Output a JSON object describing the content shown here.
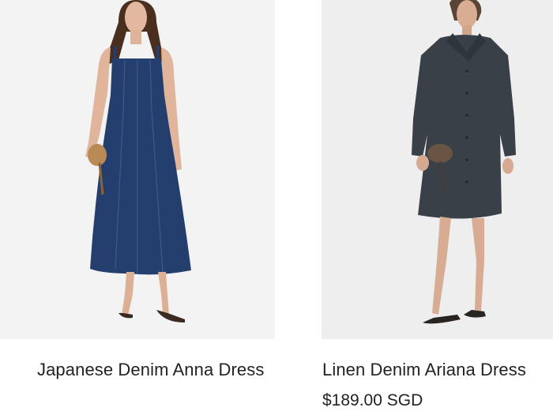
{
  "products": [
    {
      "name": "Japanese Denim Anna Dress",
      "image_alt": "Model wearing a dark blue sleeveless denim midi dress",
      "price": ""
    },
    {
      "name": "Linen Denim Ariana Dress",
      "image_alt": "Model wearing a charcoal long-sleeve linen denim shirt dress",
      "price": "$189.00 SGD"
    }
  ],
  "colors": {
    "text": "#222222",
    "left_background": "#f3f3f3",
    "right_background": "#eeeeee",
    "denim_dark_blue": "#243f6e",
    "linen_charcoal": "#3a4048"
  }
}
